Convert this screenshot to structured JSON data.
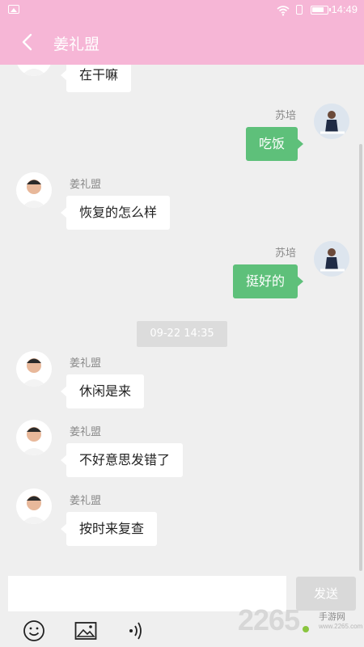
{
  "status_bar": {
    "time": "14:49"
  },
  "header": {
    "title": "姜礼盟"
  },
  "messages": [
    {
      "side": "left",
      "name": "",
      "text": "在干嘛"
    },
    {
      "side": "right",
      "name": "苏培",
      "text": "吃饭"
    },
    {
      "side": "left",
      "name": "姜礼盟",
      "text": "恢复的怎么样"
    },
    {
      "side": "right",
      "name": "苏培",
      "text": "挺好的"
    },
    {
      "side": "left",
      "name": "姜礼盟",
      "text": "休闲是来"
    },
    {
      "side": "left",
      "name": "姜礼盟",
      "text": "不好意思发错了"
    },
    {
      "side": "left",
      "name": "姜礼盟",
      "text": "按时来复查"
    }
  ],
  "timestamp": "09-22 14:35",
  "input": {
    "placeholder": "",
    "value": ""
  },
  "send_label": "发送",
  "toolbar": {
    "emoji": "emoji-icon",
    "image": "image-icon",
    "voice": "voice-icon"
  },
  "watermark": {
    "brand": "2265",
    "site": "手游网",
    "url": "www.2265.com"
  },
  "colors": {
    "header": "#f6b6d6",
    "sent_bubble": "#5ec07a",
    "background": "#efefef"
  }
}
